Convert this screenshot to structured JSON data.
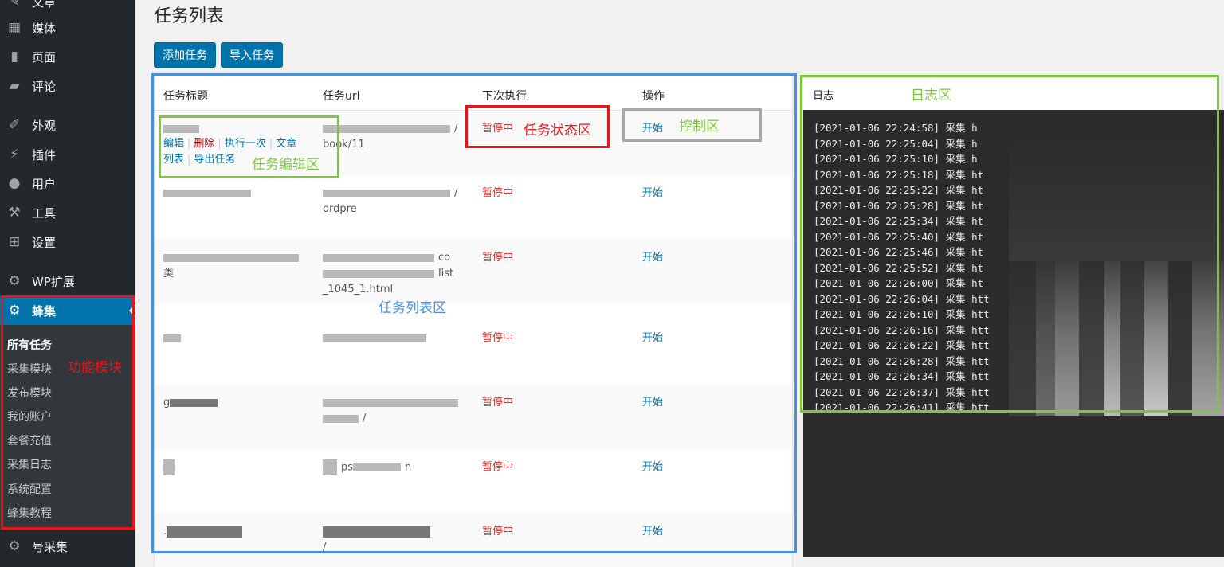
{
  "sidebar": {
    "items": [
      {
        "label": "文章",
        "icon": "pin-icon"
      },
      {
        "label": "媒体",
        "icon": "media-icon"
      },
      {
        "label": "页面",
        "icon": "page-icon"
      },
      {
        "label": "评论",
        "icon": "comment-icon"
      },
      {
        "label": "外观",
        "icon": "brush-icon"
      },
      {
        "label": "插件",
        "icon": "plugin-icon"
      },
      {
        "label": "用户",
        "icon": "user-icon"
      },
      {
        "label": "工具",
        "icon": "wrench-icon"
      },
      {
        "label": "设置",
        "icon": "settings-icon"
      },
      {
        "label": "WP扩展",
        "icon": "gear-icon"
      },
      {
        "label": "蜂集",
        "icon": "gear-icon",
        "active": true
      },
      {
        "label": "号采集",
        "icon": "gear-icon"
      }
    ],
    "submenu": [
      "所有任务",
      "采集模块",
      "发布模块",
      "我的账户",
      "套餐充值",
      "采集日志",
      "系统配置",
      "蜂集教程"
    ]
  },
  "page": {
    "title": "任务列表",
    "buttons": {
      "add": "添加任务",
      "import": "导入任务"
    }
  },
  "table": {
    "headers": {
      "title": "任务标题",
      "url": "任务url",
      "next": "下次执行",
      "action": "操作"
    },
    "row_actions": {
      "edit": "编辑",
      "delete": "删除",
      "run_once": "执行一次",
      "article": "文章",
      "list": "列表",
      "export": "导出任务"
    },
    "url_fragments": {
      "r0a": "/",
      "r0b": "book/11",
      "r1a": "/",
      "r1b": "ordpre",
      "r2t": "类",
      "r2a": "co",
      "r2b": "list",
      "r2c": "_1045_1.html",
      "r4t": "g",
      "r4b": "/",
      "r5t": "ps",
      "r5a": "n",
      "r6t": ".",
      "r6b": "/"
    },
    "status": "暂停中",
    "action": "开始",
    "rows": 7
  },
  "log": {
    "label": "日志",
    "lines": [
      "[2021-01-06 22:24:58] 采集 h",
      "[2021-01-06 22:25:04] 采集 h",
      "[2021-01-06 22:25:10] 采集 h",
      "[2021-01-06 22:25:18] 采集 ht",
      "[2021-01-06 22:25:22] 采集 ht",
      "[2021-01-06 22:25:28] 采集 ht",
      "[2021-01-06 22:25:34] 采集 ht",
      "[2021-01-06 22:25:40] 采集 ht",
      "[2021-01-06 22:25:46] 采集 ht",
      "[2021-01-06 22:25:52] 采集 ht",
      "[2021-01-06 22:26:00] 采集 ht",
      "[2021-01-06 22:26:04] 采集 htt",
      "[2021-01-06 22:26:10] 采集 htt",
      "[2021-01-06 22:26:16] 采集 htt",
      "[2021-01-06 22:26:22] 采集 htt",
      "[2021-01-06 22:26:28] 采集 htt",
      "[2021-01-06 22:26:34] 采集 htt",
      "[2021-01-06 22:26:37] 采集 htt",
      "[2021-01-06 22:26:41] 采集 htt"
    ]
  },
  "annotations": {
    "feature_module": "功能模块",
    "task_status": "任务状态区",
    "control": "控制区",
    "task_edit": "任务编辑区",
    "task_list": "任务列表区",
    "log_area": "日志区"
  },
  "colors": {
    "red": "#e8161b",
    "green": "#7dc73d",
    "blue": "#4a90e2",
    "gray": "#a8a8a8",
    "wp_blue": "#0073aa"
  }
}
